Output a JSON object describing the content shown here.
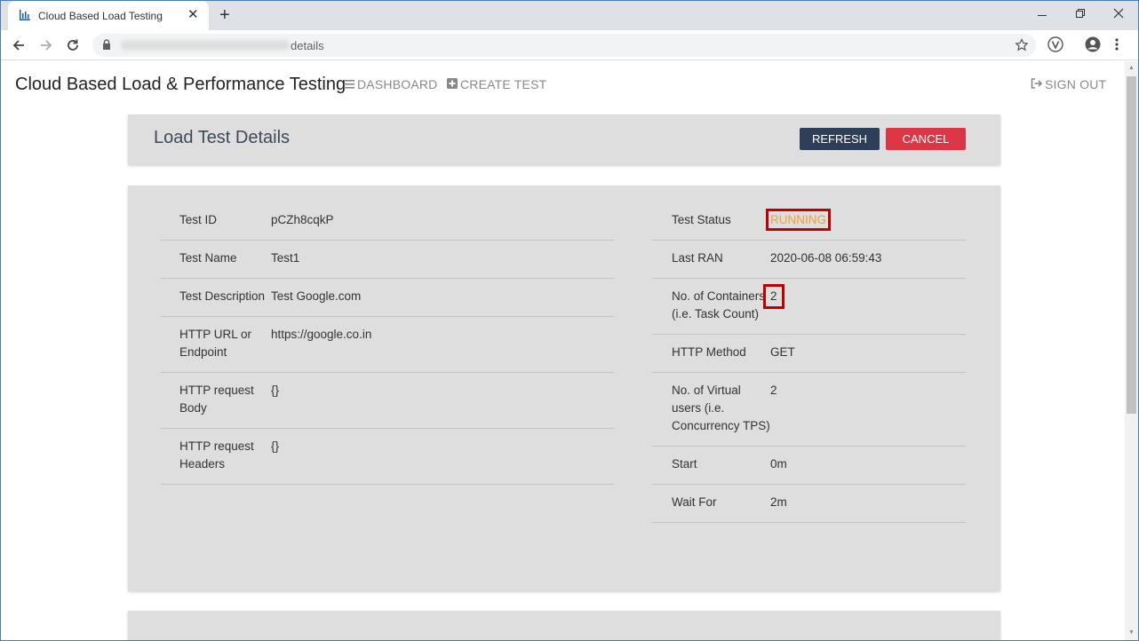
{
  "browser": {
    "tab_title": "Cloud Based Load Testing",
    "url_suffix": "details",
    "new_tab_glyph": "+",
    "close_glyph": "✕"
  },
  "nav": {
    "brand": "Cloud Based Load & Performance Testing",
    "dashboard": "DASHBOARD",
    "create_test": "CREATE TEST",
    "sign_out": "SIGN OUT"
  },
  "header": {
    "title": "Load Test Details",
    "refresh": "REFRESH",
    "cancel": "CANCEL"
  },
  "details_left": [
    {
      "label": "Test ID",
      "value": "pCZh8cqkP"
    },
    {
      "label": "Test Name",
      "value": "Test1"
    },
    {
      "label": "Test Description",
      "value": "Test Google.com"
    },
    {
      "label": "HTTP URL or Endpoint",
      "value": "https://google.co.in"
    },
    {
      "label": "HTTP request Body",
      "value": "{}"
    },
    {
      "label": "HTTP request Headers",
      "value": "{}"
    }
  ],
  "details_right": [
    {
      "label": "Test Status",
      "value": "RUNNING"
    },
    {
      "label": "Last RAN",
      "value": "2020-06-08 06:59:43"
    },
    {
      "label": "No. of Containers (i.e. Task Count)",
      "value": "2"
    },
    {
      "label": "HTTP Method",
      "value": "GET"
    },
    {
      "label": "No. of Virtual users (i.e. Concurrency TPS)",
      "value": "2"
    },
    {
      "label": "Start",
      "value": "0m"
    },
    {
      "label": "Wait For",
      "value": "2m"
    }
  ],
  "colors": {
    "accent_dark": "#2c3e58",
    "danger": "#dc3545",
    "status_running": "#f0a030",
    "highlight": "#c00000"
  }
}
